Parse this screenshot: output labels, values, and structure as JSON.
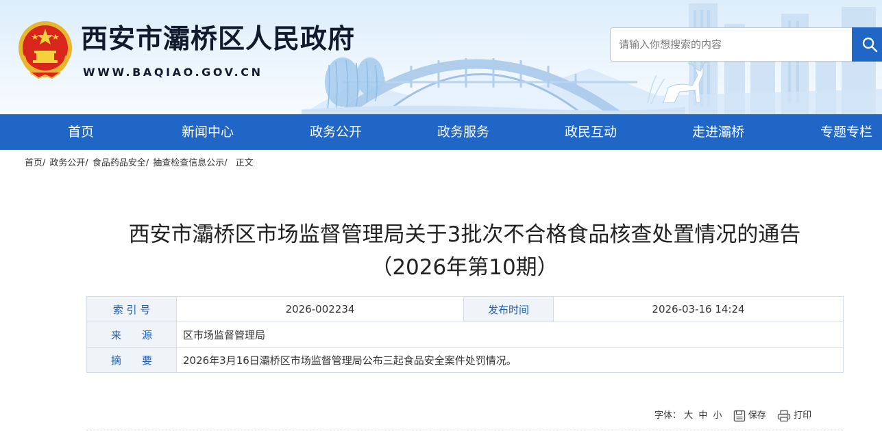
{
  "site": {
    "title": "西安市灞桥区人民政府",
    "url": "WWW.BAQIAO.GOV.CN",
    "logo": "national-emblem"
  },
  "search": {
    "placeholder": "请输入你想搜索的内容",
    "button_icon": "search-icon"
  },
  "nav": {
    "items": [
      {
        "label": "首页"
      },
      {
        "label": "新闻中心"
      },
      {
        "label": "政务公开"
      },
      {
        "label": "政务服务"
      },
      {
        "label": "政民互动"
      },
      {
        "label": "走进灞桥"
      },
      {
        "label": "专题专栏"
      }
    ]
  },
  "breadcrumb": {
    "items": [
      {
        "label": "首页"
      },
      {
        "label": "政务公开"
      },
      {
        "label": "食品药品安全"
      },
      {
        "label": "抽查检查信息公示"
      }
    ],
    "separator": "/",
    "current": "正文"
  },
  "article": {
    "title_line1": "西安市灞桥区市场监督管理局关于3批次不合格食品核查处置情况的通告",
    "title_line2": "（2026年第10期）"
  },
  "info": {
    "index_label": "索 引 号",
    "index_value": "2026-002234",
    "publish_label": "发布时间",
    "publish_value": "2026-03-16 14:24",
    "source_label": "来　　源",
    "source_value": "区市场监督管理局",
    "summary_label": "摘　　要",
    "summary_value": "2026年3月16日灞桥区市场监督管理局公布三起食品安全案件处罚情况。"
  },
  "tools": {
    "font_label": "字体：",
    "font_large": "大",
    "font_medium": "中",
    "font_small": "小",
    "save_label": "保存",
    "save_icon": "save-icon",
    "print_label": "打印",
    "print_icon": "print-icon"
  },
  "colors": {
    "nav_bg": "#1f66c6",
    "label_text": "#1f5fb8",
    "label_bg": "#f0f3f7",
    "border": "#d6dce4"
  }
}
